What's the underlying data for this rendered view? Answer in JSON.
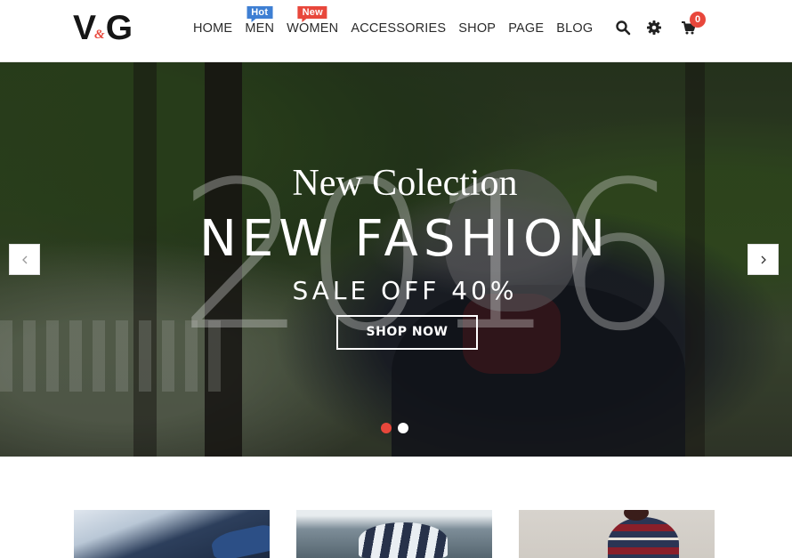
{
  "header": {
    "logo": {
      "v": "V",
      "amp": "&",
      "g": "G"
    },
    "nav": [
      {
        "label": "HOME"
      },
      {
        "label": "MEN",
        "badge": "Hot"
      },
      {
        "label": "WOMEN",
        "badge": "New"
      },
      {
        "label": "ACCESSORIES"
      },
      {
        "label": "SHOP"
      },
      {
        "label": "PAGE"
      },
      {
        "label": "BLOG"
      }
    ],
    "icons": {
      "search": "search-icon",
      "settings": "gear-icon",
      "cart": "cart-icon"
    },
    "cart_count": "0"
  },
  "hero": {
    "big_text": "2016",
    "subtitle": "New Colection",
    "title": "NEW FASHION",
    "sale_text": "SALE OFF 40%",
    "button_label": "SHOP NOW",
    "slide_count": 2,
    "active_slide": 1
  },
  "colors": {
    "accent": "#e8473b",
    "hot_badge": "#3e7fd3",
    "text_dark": "#2b2b2b"
  }
}
